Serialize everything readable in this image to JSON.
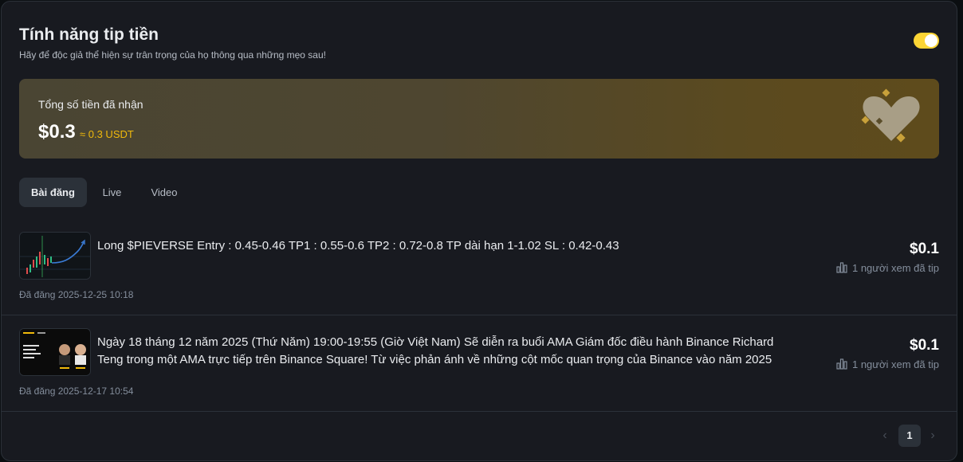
{
  "header": {
    "title": "Tính năng tip tiền",
    "subtitle": "Hãy để độc giả thể hiện sự trân trọng của họ thông qua những mẹo sau!",
    "toggle_on": true
  },
  "summary": {
    "label": "Tổng số tiền đã nhận",
    "value": "$0.3",
    "approx": "≈ 0.3 USDT",
    "icon": "heart-icon"
  },
  "tabs": [
    {
      "label": "Bài đăng",
      "active": true
    },
    {
      "label": "Live",
      "active": false
    },
    {
      "label": "Video",
      "active": false
    }
  ],
  "posts": [
    {
      "title": "Long $PIEVERSE Entry : 0.45-0.46 TP1 : 0.55-0.6 TP2 : 0.72-0.8 TP dài hạn 1-1.02 SL : 0.42-0.43",
      "date": "Đã đăng 2025-12-25 10:18",
      "amount": "$0.1",
      "viewers": "1 người xem đã tip",
      "thumbnail": "chart-thumbnail"
    },
    {
      "title": "Ngày 18 tháng 12 năm 2025 (Thứ Năm) 19:00-19:55 (Giờ Việt Nam) Sẽ diễn ra buổi AMA Giám đốc điều hành Binance Richard Teng trong một AMA trực tiếp trên Binance Square! Từ việc phản ánh về những cột mốc quan trọng của Binance vào năm 2025",
      "date": "Đã đăng 2025-12-17 10:54",
      "amount": "$0.1",
      "viewers": "1 người xem đã tip",
      "thumbnail": "ama-thumbnail"
    }
  ],
  "pagination": {
    "current": "1",
    "prev_icon": "chevron-left-icon",
    "next_icon": "chevron-right-icon"
  },
  "colors": {
    "accent": "#fcd535",
    "gold": "#f0b90b",
    "background": "#181a20",
    "divider": "#2b3139"
  }
}
